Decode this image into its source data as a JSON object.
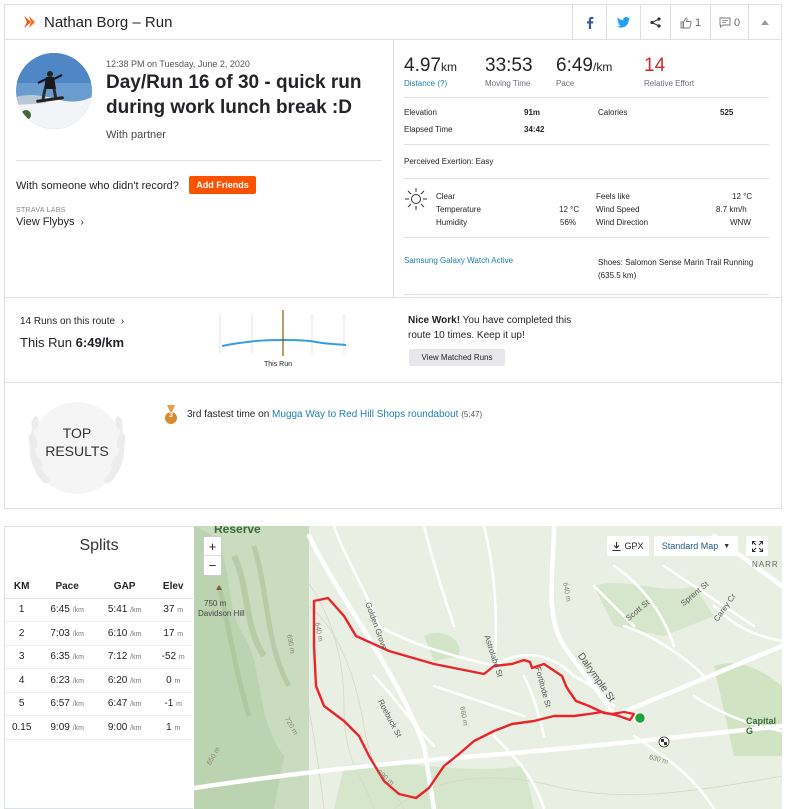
{
  "header": {
    "title": "Nathan Borg – Run",
    "kudos_count": "1",
    "comments_count": "0"
  },
  "activity": {
    "datetime": "12:38 PM on Tuesday, June 2, 2020",
    "title": "Day/Run 16 of 30 - quick run during work lunch break :D",
    "with_partner": "With partner",
    "someone_text": "With someone who didn't record?",
    "add_friends": "Add Friends",
    "labs": "STRAVA LABS",
    "flybys": "View Flybys"
  },
  "stats": {
    "distance": {
      "value": "4.97",
      "unit": "km",
      "label": "Distance (?)"
    },
    "moving_time": {
      "value": "33:53",
      "label": "Moving Time"
    },
    "pace": {
      "value": "6:49",
      "unit": "/km",
      "label": "Pace"
    },
    "relative_effort": {
      "value": "14",
      "label": "Relative Effort"
    },
    "elevation": {
      "label": "Elevation",
      "value": "91m"
    },
    "elapsed": {
      "label": "Elapsed Time",
      "value": "34:42"
    },
    "calories": {
      "label": "Calories",
      "value": "525"
    },
    "perceived": "Perceived Exertion: Easy"
  },
  "weather": {
    "condition": "Clear",
    "temperature": {
      "label": "Temperature",
      "value": "12 °C"
    },
    "humidity": {
      "label": "Humidity",
      "value": "56%"
    },
    "feels_like": {
      "label": "Feels like",
      "value": "12 °C"
    },
    "wind_speed": {
      "label": "Wind Speed",
      "value": "8.7 km/h"
    },
    "wind_direction": {
      "label": "Wind Direction",
      "value": "WNW"
    }
  },
  "device": "Samsung Galaxy Watch Active",
  "shoes": "Shoes: Salomon Sense Marin Trail Running (635.5 km)",
  "route": {
    "runs_link": "14 Runs on this route",
    "this_run_label": "This Run",
    "this_run_pace": "6:49/km",
    "chart_caption": "This Run",
    "nice_work_bold": "Nice Work!",
    "nice_work_text": "You have completed this route 10 times. Keep it up!",
    "view_matched": "View Matched Runs"
  },
  "top_results": {
    "badge_line1": "TOP",
    "badge_line2": "RESULTS",
    "medal": "3",
    "achievement_prefix": "3rd fastest time",
    "achievement_on": "on",
    "segment": "Mugga Way to Red Hill Shops roundabout",
    "segment_time": "(5:47)"
  },
  "splits": {
    "title": "Splits",
    "columns": [
      "KM",
      "Pace",
      "GAP",
      "Elev"
    ],
    "unit": "/km",
    "elev_unit": "m",
    "rows": [
      {
        "km": "1",
        "pace": "6:45",
        "gap": "5:41",
        "elev": "37"
      },
      {
        "km": "2",
        "pace": "7:03",
        "gap": "6:10",
        "elev": "17"
      },
      {
        "km": "3",
        "pace": "6:35",
        "gap": "7:12",
        "elev": "-52"
      },
      {
        "km": "4",
        "pace": "6:23",
        "gap": "6:20",
        "elev": "0"
      },
      {
        "km": "5",
        "pace": "6:57",
        "gap": "6:47",
        "elev": "-1"
      },
      {
        "km": "0.15",
        "pace": "9:09",
        "gap": "9:00",
        "elev": "1"
      }
    ]
  },
  "map": {
    "gpx": "GPX",
    "map_type": "Standard Map",
    "zoom_in": "+",
    "zoom_out": "−",
    "labels": {
      "reserve": "Reserve",
      "hill_height": "750 m",
      "hill": "Davidson Hill",
      "golden_grove": "Golden Grove",
      "astrolabe": "Astrolabe St",
      "fortitude": "Fortitude St",
      "dalrymple": "Dalrymple St",
      "roebuck": "Roebuck St",
      "scott": "Scott St",
      "sprent": "Sprent St",
      "carey": "Carey Cr",
      "narr": "NARR",
      "capital": "Capital G",
      "c640a": "640 m",
      "c640b": "640 m",
      "c660": "660 m",
      "c690a": "690 m",
      "c690b": "690 m",
      "c720": "720 m",
      "c650": "650 m",
      "c630": "630 m"
    }
  },
  "colors": {
    "brand": "#fc5200",
    "link": "#1e7fb0",
    "relative_effort": "#cc2d2d",
    "route": "#e8262c"
  }
}
